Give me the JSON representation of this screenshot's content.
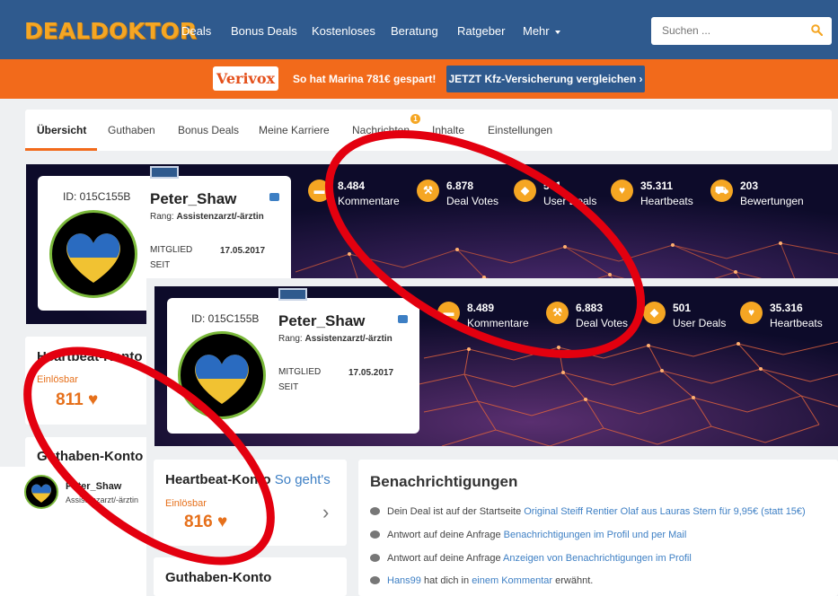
{
  "header": {
    "logo": "DEALDOKTOR",
    "nav": [
      "Deals",
      "Bonus Deals",
      "Kostenloses",
      "Beratung",
      "Ratgeber",
      "Mehr"
    ],
    "search_placeholder": "Suchen ..."
  },
  "promo": {
    "brand": "Verivox",
    "text": "So hat Marina 781€ gespart!",
    "button": "JETZT Kfz-Versicherung vergleichen"
  },
  "tabs": {
    "items": [
      "Übersicht",
      "Guthaben",
      "Bonus Deals",
      "Meine Karriere",
      "Nachrichten",
      "Inhalte",
      "Einstellungen"
    ],
    "active": "Übersicht",
    "badge": "1"
  },
  "profile_back": {
    "id": "ID: 015C155B",
    "name": "Peter_Shaw",
    "rank_label": "Rang:",
    "rank": "Assistenzarzt/-ärztin",
    "member_label_1": "MITGLIED",
    "member_label_2": "SEIT",
    "member_since": "17.05.2017",
    "stats": [
      {
        "value": "8.484",
        "label": "Kommentare",
        "icon": "comment-icon"
      },
      {
        "value": "6.878",
        "label": "Deal Votes",
        "icon": "hammer-icon"
      },
      {
        "value": "501",
        "label": "User Deals",
        "icon": "tag-icon"
      },
      {
        "value": "35.311",
        "label": "Heartbeats",
        "icon": "heart-icon"
      },
      {
        "value": "203",
        "label": "Bewertungen",
        "icon": "cart-icon"
      }
    ]
  },
  "profile_front": {
    "id": "ID: 015C155B",
    "name": "Peter_Shaw",
    "rank_label": "Rang:",
    "rank": "Assistenzarzt/-ärztin",
    "member_label_1": "MITGLIED",
    "member_label_2": "SEIT",
    "member_since": "17.05.2017",
    "stats": [
      {
        "value": "8.489",
        "label": "Kommentare",
        "icon": "comment-icon"
      },
      {
        "value": "6.883",
        "label": "Deal Votes",
        "icon": "hammer-icon"
      },
      {
        "value": "501",
        "label": "User Deals",
        "icon": "tag-icon"
      },
      {
        "value": "35.316",
        "label": "Heartbeats",
        "icon": "heart-icon"
      }
    ]
  },
  "heartbeat_back": {
    "title": "Heartbeat-Konto",
    "redeemable": "Einlösbar",
    "value": "811"
  },
  "guthaben_back": {
    "title": "Guthaben-Konto",
    "user_name": "Peter_Shaw",
    "user_rank": "Assistenzarzt/-ärztin"
  },
  "heartbeat_front": {
    "title": "Heartbeat-Konto",
    "link": "So geht's",
    "redeemable": "Einlösbar",
    "value": "816"
  },
  "guthaben_front": {
    "title": "Guthaben-Konto"
  },
  "notifications": {
    "title": "Benachrichtigungen",
    "items": [
      {
        "text": "Dein Deal ist auf der Startseite ",
        "link": "Original Steiff Rentier Olaf aus Lauras Stern für 9,95€ (statt 15€)",
        "after": ""
      },
      {
        "text": "Antwort auf deine Anfrage ",
        "link": "Benachrichtigungen im Profil und per Mail",
        "after": ""
      },
      {
        "text": "Antwort auf deine Anfrage ",
        "link": "Anzeigen von Benachrichtigungen im Profil",
        "after": ""
      },
      {
        "text": "",
        "link": "Hans99",
        "mid": " hat dich in ",
        "link2": "einem Kommentar",
        "after": " erwähnt."
      }
    ]
  },
  "colors": {
    "brand_blue": "#2f5a8e",
    "brand_orange": "#f26a1b",
    "accent_orange": "#e6701b",
    "annotation_red": "#e3000f"
  }
}
